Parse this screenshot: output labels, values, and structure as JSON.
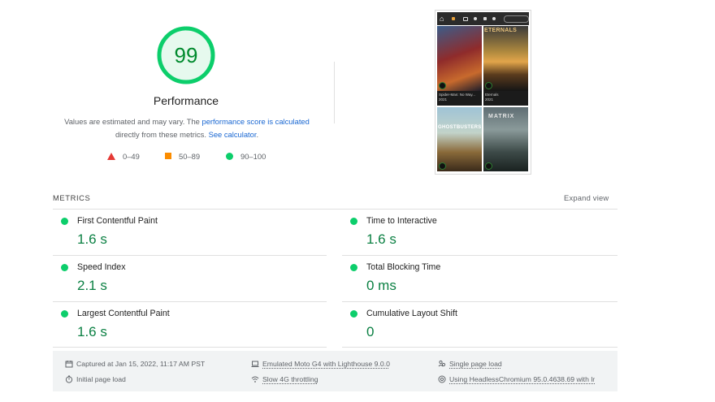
{
  "score": {
    "value": "99",
    "fraction": 0.99,
    "title": "Performance",
    "color": "#0cce6b"
  },
  "description": {
    "prefix": "Values are estimated and may vary. The ",
    "link1": "performance score is calculated",
    "middle": " directly from these metrics. ",
    "link2": "See calculator",
    "suffix": "."
  },
  "legend": [
    {
      "shape": "triangle",
      "color": "#e53935",
      "label": "0–49"
    },
    {
      "shape": "square",
      "color": "#fb8c00",
      "label": "50–89"
    },
    {
      "shape": "circle",
      "color": "#0cce6b",
      "label": "90–100"
    }
  ],
  "screenshot": {
    "nav_icons": [
      "home-icon",
      "movie-icon",
      "tv-icon",
      "person-icon",
      "tag-icon",
      "moon-icon",
      "search-icon"
    ],
    "posters": [
      {
        "text": "",
        "caption_title": "Spider-Man: No Way...",
        "caption_year": "2021"
      },
      {
        "text": "ETERNALS",
        "caption_title": "Eternals",
        "caption_year": "2021"
      },
      {
        "text": "GHOSTBUSTERS",
        "caption_title": "",
        "caption_year": ""
      },
      {
        "text": "MATRIX",
        "caption_title": "",
        "caption_year": ""
      }
    ]
  },
  "metrics": {
    "label": "METRICS",
    "expand": "Expand view",
    "items": [
      {
        "name": "First Contentful Paint",
        "value": "1.6 s",
        "status": "pass"
      },
      {
        "name": "Time to Interactive",
        "value": "1.6 s",
        "status": "pass"
      },
      {
        "name": "Speed Index",
        "value": "2.1 s",
        "status": "pass"
      },
      {
        "name": "Total Blocking Time",
        "value": "0 ms",
        "status": "pass"
      },
      {
        "name": "Largest Contentful Paint",
        "value": "1.6 s",
        "status": "pass"
      },
      {
        "name": "Cumulative Layout Shift",
        "value": "0",
        "status": "pass"
      }
    ]
  },
  "footer": {
    "captured": "Captured at Jan 15, 2022, 11:17 AM PST",
    "emulated": "Emulated Moto G4 with Lighthouse 9.0.0",
    "single_page": "Single page load",
    "initial_load": "Initial page load",
    "throttling": "Slow 4G throttling",
    "using": "Using HeadlessChromium 95.0.4638.69 with lr"
  }
}
